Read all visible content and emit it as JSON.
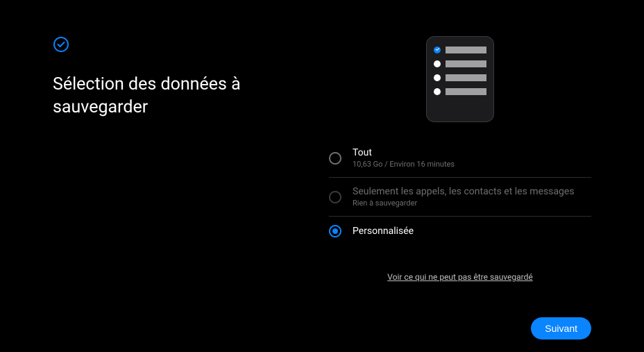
{
  "header": {
    "title": "Sélection des données à sauvegarder"
  },
  "options": [
    {
      "title": "Tout",
      "subtitle": "10,63 Go / Environ 16 minutes",
      "selected": false,
      "disabled": false
    },
    {
      "title": "Seulement les appels, les contacts et les messages",
      "subtitle": "Rien à sauvegarder",
      "selected": false,
      "disabled": true
    },
    {
      "title": "Personnalisée",
      "subtitle": "",
      "selected": true,
      "disabled": false
    }
  ],
  "secondaryLink": {
    "label": "Voir ce qui ne peut pas être sauvegardé"
  },
  "footer": {
    "nextButton": "Suivant"
  },
  "colors": {
    "accent": "#0a84ff",
    "background": "#000000"
  }
}
